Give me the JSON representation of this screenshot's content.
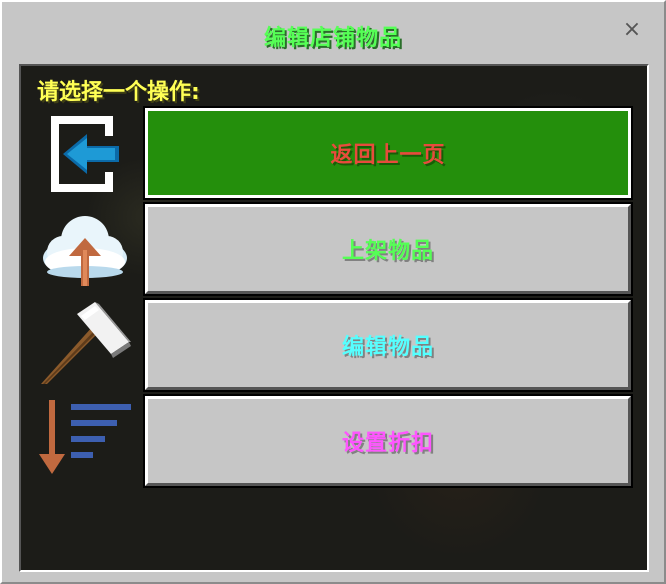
{
  "window": {
    "title": "编辑店铺物品",
    "close_symbol": "×"
  },
  "panel": {
    "prompt": "请选择一个操作:"
  },
  "options": [
    {
      "label": "返回上一页",
      "color": "#e84b3c",
      "icon": "back-arrow-icon",
      "selected": true
    },
    {
      "label": "上架物品",
      "color": "#55ff55",
      "icon": "cloud-upload-icon",
      "selected": false
    },
    {
      "label": "编辑物品",
      "color": "#55ffff",
      "icon": "hammer-icon",
      "selected": false
    },
    {
      "label": "设置折扣",
      "color": "#ff55ff",
      "icon": "sort-list-icon",
      "selected": false
    }
  ],
  "colors": {
    "window_bg": "#c6c6c6",
    "panel_bg": "#1c1c18",
    "selected_bg": "#248f0c",
    "title": "#55ff55",
    "prompt": "#ffff55"
  }
}
